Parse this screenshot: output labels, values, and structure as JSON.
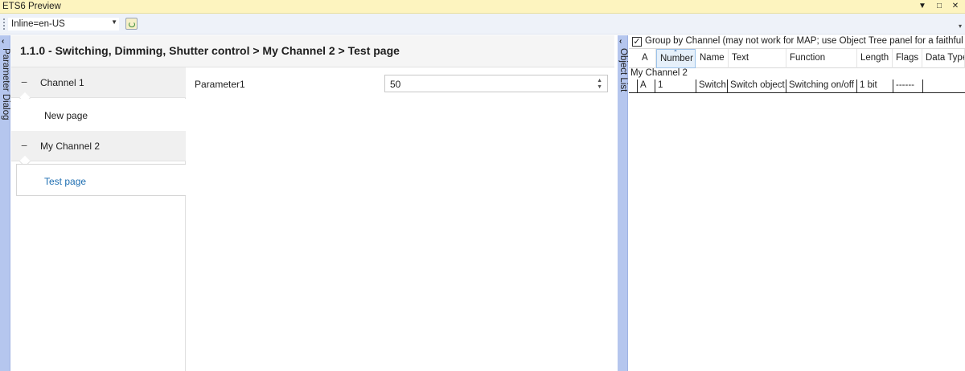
{
  "window": {
    "title": "ETS6 Preview",
    "buttons": [
      "▼",
      "□",
      "✕"
    ]
  },
  "toolbar": {
    "language_select": "Inline=en-US",
    "overflow_glyph": "▾"
  },
  "parameter_dialog": {
    "tab_label": "Parameter Dialog",
    "breadcrumb": "1.1.0 - Switching, Dimming, Shutter control > My Channel 2 > Test page",
    "tree": [
      {
        "group": "Channel 1",
        "pages": [
          "New page"
        ]
      },
      {
        "group": "My Channel 2",
        "pages": [
          "Test page"
        ]
      }
    ],
    "selected_page": "Test page",
    "parameters": [
      {
        "label": "Parameter1",
        "value": "50"
      }
    ]
  },
  "object_list": {
    "tab_label": "Object List",
    "group_by_checked": true,
    "group_by_text": "Group by Channel (may not work for MAP; use Object Tree panel for a faithful r",
    "columns": [
      "A",
      "Number",
      "Name",
      "Text",
      "Function",
      "Length",
      "Flags",
      "Data Type"
    ],
    "sorted_column": "Number",
    "group_label": "My Channel 2",
    "rows": [
      [
        "A",
        "1",
        "Switch",
        "Switch object",
        "Switching on/off",
        "1 bit",
        "------",
        ""
      ]
    ]
  },
  "colors": {
    "title_bar": "#fdf4bf",
    "tab_strip": "#b5c6ee",
    "selected_page_text": "#1f6fb2"
  }
}
